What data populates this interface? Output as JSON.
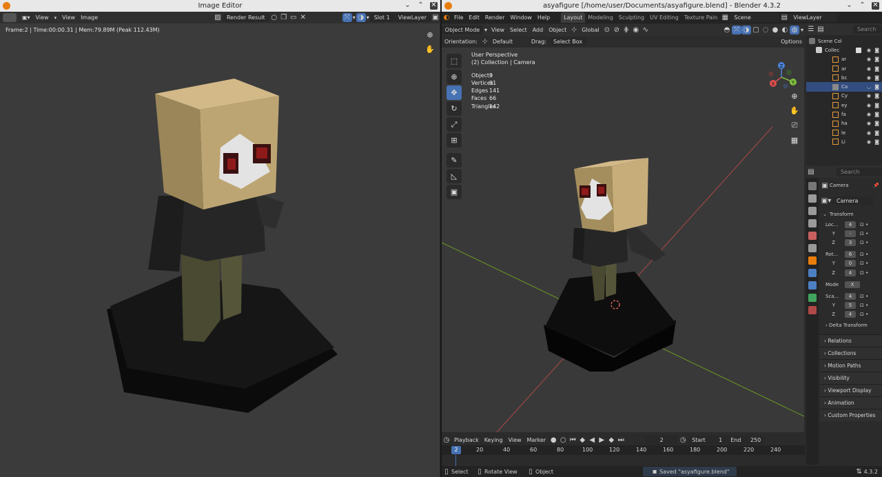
{
  "left_window": {
    "title": "Image Editor",
    "menu": [
      "View",
      "View",
      "Image"
    ],
    "image_name": "Render Result",
    "slot": "Slot 1",
    "layer": "ViewLayer",
    "info": "Frame:2 | Time:00:00.31 | Mem:79.89M (Peak 112.43M)"
  },
  "right_window": {
    "title": "asyafigure [/home/user/Documents/asyafigure.blend] - Blender 4.3.2",
    "menu": [
      "File",
      "Edit",
      "Render",
      "Window",
      "Help"
    ],
    "workspaces": [
      "Layout",
      "Modeling",
      "Sculpting",
      "UV Editing",
      "Texture Pain"
    ],
    "scene": "Scene",
    "view_layer": "ViewLayer",
    "mode": "Object Mode",
    "vp_menu": [
      "View",
      "Select",
      "Add",
      "Object"
    ],
    "transform_space": "Global",
    "orientation_label": "Orientation:",
    "orientation": "Default",
    "drag_label": "Drag:",
    "drag": "Select Box",
    "options": "Options",
    "overlay": {
      "view": "User Perspective",
      "collection": "(2) Collection | Camera",
      "stats": [
        {
          "k": "Objects",
          "v": "9"
        },
        {
          "k": "Vertices",
          "v": "91"
        },
        {
          "k": "Edges",
          "v": "141"
        },
        {
          "k": "Faces",
          "v": "66"
        },
        {
          "k": "Triangles",
          "v": "142"
        }
      ]
    },
    "gizmo": {
      "x": "X",
      "y": "Y",
      "z": "Z"
    },
    "outliner": {
      "search": "Search",
      "root": "Scene Col",
      "collection": "Collec",
      "items": [
        "ar",
        "ar",
        "bc",
        "Ca",
        "Cy",
        "ey",
        "fa",
        "ha",
        "le",
        "Li"
      ]
    },
    "properties": {
      "search": "Search",
      "object": "Camera",
      "data": "Camera",
      "transform": "Transform",
      "loc_label": "Loc...",
      "loc": [
        "4",
        "-",
        "3"
      ],
      "rot_label": "Rot...",
      "rot": [
        "6",
        "0",
        "4"
      ],
      "mode_label": "Mode",
      "mode": "X",
      "scale_label": "Sca...",
      "scale": [
        "4",
        "5",
        "4"
      ],
      "y": "Y",
      "z": "Z",
      "delta": "Delta Transform",
      "panels": [
        "Relations",
        "Collections",
        "Motion Paths",
        "Visibility",
        "Viewport Display",
        "Animation",
        "Custom Properties"
      ]
    },
    "timeline": {
      "menu": [
        "Playback",
        "Keying",
        "View",
        "Marker"
      ],
      "current_frame": "2",
      "start_label": "Start",
      "start": "1",
      "end_label": "End",
      "end": "250",
      "ticks": [
        "2",
        "20",
        "40",
        "60",
        "80",
        "100",
        "120",
        "140",
        "160",
        "180",
        "200",
        "220",
        "240"
      ]
    },
    "status": {
      "select": "Select",
      "rotate": "Rotate View",
      "object": "Object",
      "message": "Saved \"asyafigure.blend\"",
      "version": "4.3.2"
    }
  }
}
